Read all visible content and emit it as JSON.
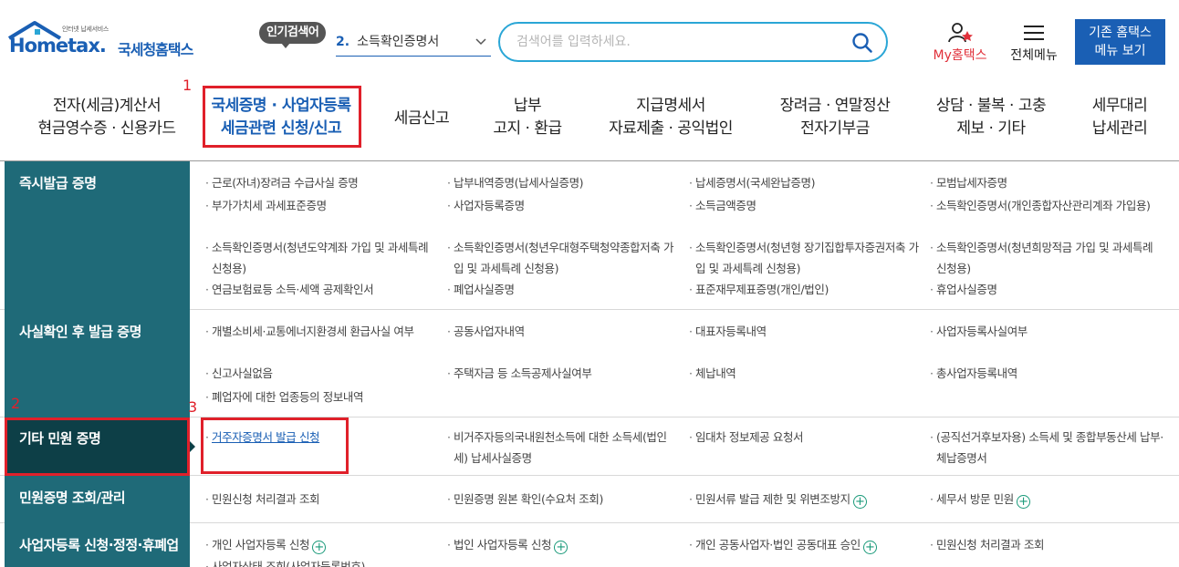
{
  "logo": {
    "small_text": "인터넷 납세서비스",
    "brand": "Hometax.",
    "brand_kr": "국세청홈택스"
  },
  "popular": {
    "badge": "인기검색어",
    "rank": "2.",
    "keyword": "소득확인증명서"
  },
  "search": {
    "placeholder": "검색어를 입력하세요."
  },
  "util": {
    "my_home": "My홈택스",
    "all_menu": "전체메뉴",
    "classic_line1": "기존 홈택스",
    "classic_line2": "메뉴 보기"
  },
  "colors": {
    "brand_blue": "#1a5fb4",
    "teal_head": "#1f6a78",
    "teal_selected": "#0d3f47",
    "annotation_red": "#e0202a"
  },
  "gnb": [
    {
      "line1": "전자(세금)계산서",
      "line2": "현금영수증 · 신용카드"
    },
    {
      "line1": "국세증명 · 사업자등록",
      "line2": "세금관련 신청/신고"
    },
    {
      "line1": "세금신고",
      "line2": ""
    },
    {
      "line1": "납부",
      "line2": "고지 · 환급"
    },
    {
      "line1": "지급명세서",
      "line2": "자료제출 · 공익법인"
    },
    {
      "line1": "장려금 · 연말정산",
      "line2": "전자기부금"
    },
    {
      "line1": "상담 · 불복 · 고충",
      "line2": "제보 · 기타"
    },
    {
      "line1": "세무대리",
      "line2": "납세관리"
    }
  ],
  "annotations": [
    "1",
    "2",
    "3"
  ],
  "rows": [
    {
      "head": "즉시발급 증명",
      "items": [
        "근로(자녀)장려금 수급사실 증명",
        "납부내역증명(납세사실증명)",
        "납세증명서(국세완납증명)",
        "모범납세자증명",
        "부가가치세 과세표준증명",
        "사업자등록증명",
        "소득금액증명",
        "소득확인증명서(개인종합자산관리계좌 가입용)",
        "소득확인증명서(청년도약계좌 가입 및 과세특례 신청용)",
        "소득확인증명서(청년우대형주택청약종합저축 가입 및 과세특례 신청용)",
        "소득확인증명서(청년형 장기집합투자증권저축 가입 및 과세특례 신청용)",
        "소득확인증명서(청년희망적금 가입 및 과세특례 신청용)",
        "연금보험료등 소득·세액 공제확인서",
        "폐업사실증명",
        "표준재무제표증명(개인/법인)",
        "휴업사실증명"
      ]
    },
    {
      "head": "사실확인 후 발급 증명",
      "items": [
        "개별소비세·교통에너지환경세 환급사실 여부",
        "공동사업자내역",
        "대표자등록내역",
        "사업자등록사실여부",
        "신고사실없음",
        "주택자금 등 소득공제사실여부",
        "체납내역",
        "총사업자등록내역",
        "폐업자에 대한 업종등의 정보내역"
      ]
    },
    {
      "head": "기타 민원 증명",
      "items": [
        "거주자증명서 발급 신청",
        "비거주자등의국내원천소득에 대한 소득세(법인세) 납세사실증명",
        "임대차 정보제공 요청서",
        "(공직선거후보자용) 소득세 및 종합부동산세 납부·체납증명서"
      ]
    },
    {
      "head": "민원증명 조회/관리",
      "items": [
        "민원신청 처리결과 조회",
        "민원증명 원본 확인(수요처 조회)",
        "민원서류 발급 제한 및 위변조방지",
        "세무서 방문 민원"
      ]
    },
    {
      "head": "사업자등록 신청·정정·휴폐업",
      "items": [
        "개인 사업자등록 신청",
        "법인 사업자등록 신청",
        "개인 공동사업자·법인 공동대표 승인",
        "민원신청 처리결과 조회",
        "사업자상태 조회(사업자등록번호)"
      ]
    }
  ]
}
